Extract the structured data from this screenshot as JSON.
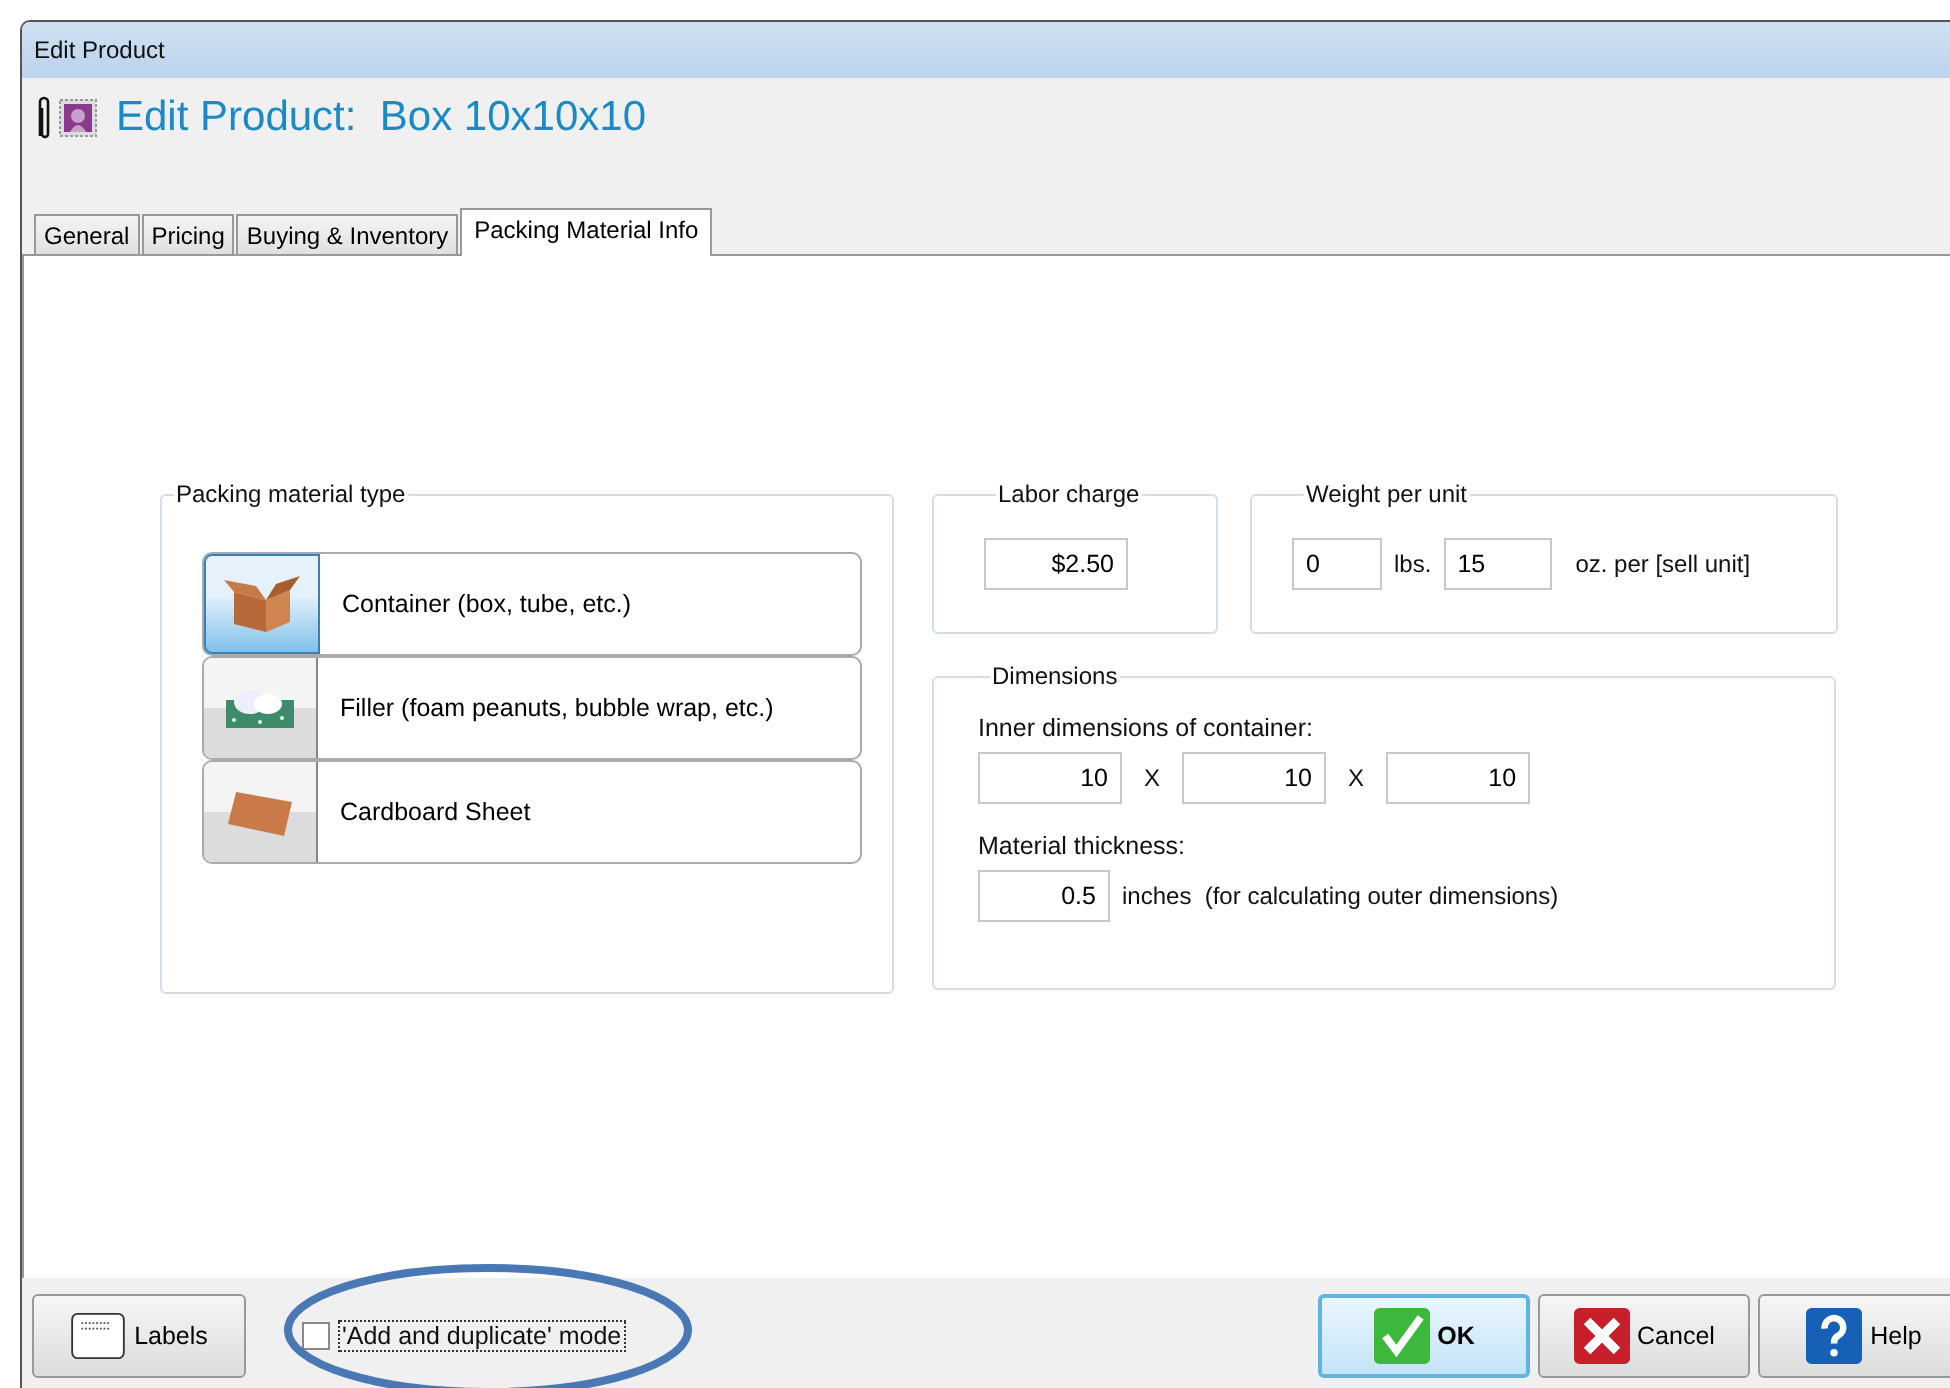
{
  "window": {
    "title": "Edit Product"
  },
  "header": {
    "title": "Edit Product:  Box 10x10x10"
  },
  "tabs": [
    {
      "label": "General",
      "selected": false
    },
    {
      "label": "Pricing",
      "selected": false
    },
    {
      "label": "Buying & Inventory",
      "selected": false
    },
    {
      "label": "Packing Material Info",
      "selected": true
    }
  ],
  "packing_material": {
    "label": "Packing material type",
    "options": [
      {
        "kind": "container",
        "label": "Container (box, tube, etc.)",
        "selected": true
      },
      {
        "kind": "filler",
        "label": "Filler (foam peanuts, bubble wrap, etc.)",
        "selected": false
      },
      {
        "kind": "sheet",
        "label": "Cardboard Sheet",
        "selected": false
      }
    ]
  },
  "labor_charge": {
    "label": "Labor charge",
    "value": "$2.50"
  },
  "weight": {
    "label": "Weight per unit",
    "lbs": "0",
    "lbs_unit": "lbs.",
    "oz": "15",
    "oz_unit": "oz. per [sell unit]"
  },
  "dimensions": {
    "label": "Dimensions",
    "inner_label": "Inner dimensions of container:",
    "values": [
      "10",
      "10",
      "10"
    ],
    "separators": [
      "X",
      "X"
    ],
    "thickness_label": "Material thickness:",
    "thickness": "0.5",
    "thickness_unit": "inches  (for calculating outer dimensions)"
  },
  "footer": {
    "labels_button": "Labels",
    "duplicate_mode": {
      "label": "'Add and duplicate' mode",
      "checked": false
    },
    "buttons": [
      {
        "kind": "ok",
        "label": "OK"
      },
      {
        "kind": "cancel",
        "label": "Cancel"
      },
      {
        "kind": "help",
        "label": "Help"
      }
    ]
  }
}
